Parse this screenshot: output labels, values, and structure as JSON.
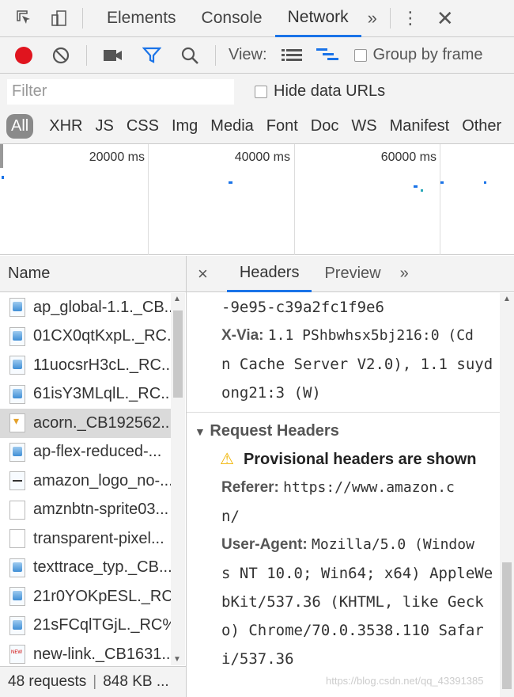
{
  "topbar": {
    "tabs": [
      "Elements",
      "Console",
      "Network"
    ],
    "active_tab": "Network",
    "more": "»",
    "menu": "⋮",
    "close": "✕"
  },
  "toolbar": {
    "view_label": "View:",
    "group_by_frame": "Group by frame"
  },
  "filter": {
    "placeholder": "Filter",
    "hide_data_urls": "Hide data URLs"
  },
  "types": [
    "All",
    "XHR",
    "JS",
    "CSS",
    "Img",
    "Media",
    "Font",
    "Doc",
    "WS",
    "Manifest",
    "Other"
  ],
  "overview": {
    "ticks": [
      "20000 ms",
      "40000 ms",
      "60000 ms"
    ]
  },
  "requests": {
    "header": "Name",
    "rows": [
      {
        "name": "ap_global-1.1._CB...",
        "icon": "img"
      },
      {
        "name": "01CX0qtKxpL._RC...",
        "icon": "img"
      },
      {
        "name": "11uocsrH3cL._RC...",
        "icon": "img"
      },
      {
        "name": "61isY3MLqlL._RC...",
        "icon": "img"
      },
      {
        "name": "acorn._CB192562...",
        "icon": "acorn",
        "selected": true
      },
      {
        "name": "ap-flex-reduced-...",
        "icon": "img"
      },
      {
        "name": "amazon_logo_no-...",
        "icon": "amz"
      },
      {
        "name": "amznbtn-sprite03...",
        "icon": "plain"
      },
      {
        "name": "transparent-pixel...",
        "icon": "plain"
      },
      {
        "name": "texttrace_typ._CB...",
        "icon": "img"
      },
      {
        "name": "21r0YOKpESL._RC...",
        "icon": "img"
      },
      {
        "name": "21sFCqlTGjL._RC%...",
        "icon": "img"
      },
      {
        "name": "new-link._CB1631...",
        "icon": "new"
      }
    ]
  },
  "status": {
    "requests": "48 requests",
    "size": "848 KB ..."
  },
  "detail": {
    "close": "×",
    "tabs": [
      "Headers",
      "Preview"
    ],
    "active_tab": "Headers",
    "more": "»",
    "lines": {
      "l1": "-9e95-c39a2fc1f9e6",
      "xvia_key": "X-Via:",
      "xvia_1": "1.1 PShbwhsx5bj216:0 (Cd",
      "xvia_2": "n Cache Server V2.0), 1.1 suyd",
      "xvia_3": "ong21:3 (W)"
    },
    "request_headers": {
      "title": "Request Headers",
      "warning": "Provisional headers are shown",
      "referer_key": "Referer:",
      "referer_1": "https://www.amazon.c",
      "referer_2": "n/",
      "ua_key": "User-Agent:",
      "ua_1": "Mozilla/5.0 (Window",
      "ua_2": "s NT 10.0; Win64; x64) AppleWe",
      "ua_3": "bKit/537.36 (KHTML, like Geck",
      "ua_4": "o) Chrome/70.0.3538.110 Safar",
      "ua_5": "i/537.36"
    }
  },
  "watermark": "https://blog.csdn.net/qq_43391385"
}
